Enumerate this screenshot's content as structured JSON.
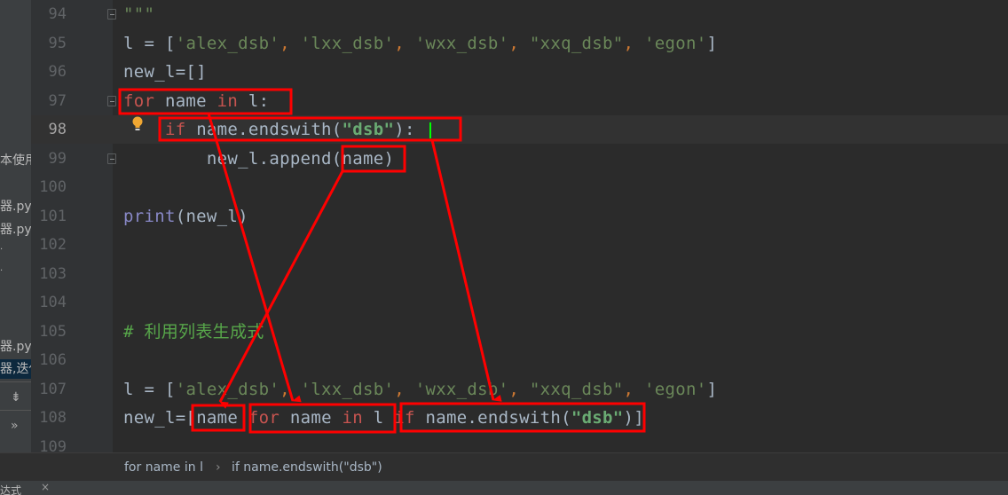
{
  "sidebar": {
    "fragments": [
      "本使用",
      "器.py",
      "器.py",
      "器.py",
      "器,迭代",
      "»"
    ]
  },
  "editor": {
    "lines": [
      {
        "num": "94",
        "tokens": [
          {
            "t": "\"\"\"",
            "c": "str"
          }
        ]
      },
      {
        "num": "95",
        "tokens": [
          {
            "t": "l = [",
            "c": ""
          },
          {
            "t": "'alex_dsb'",
            "c": "str"
          },
          {
            "t": ", ",
            "c": "kw"
          },
          {
            "t": "'lxx_dsb'",
            "c": "str"
          },
          {
            "t": ", ",
            "c": "kw"
          },
          {
            "t": "'wxx_dsb'",
            "c": "str"
          },
          {
            "t": ", ",
            "c": "kw"
          },
          {
            "t": "\"xxq_dsb\"",
            "c": "str"
          },
          {
            "t": ", ",
            "c": "kw"
          },
          {
            "t": "'egon'",
            "c": "str"
          },
          {
            "t": "]",
            "c": ""
          }
        ]
      },
      {
        "num": "96",
        "tokens": [
          {
            "t": "new_l=[]",
            "c": ""
          }
        ]
      },
      {
        "num": "97",
        "tokens": [
          {
            "t": "for",
            "c": "kwred"
          },
          {
            "t": " name ",
            "c": ""
          },
          {
            "t": "in",
            "c": "kwred"
          },
          {
            "t": " l:",
            "c": ""
          }
        ]
      },
      {
        "num": "98",
        "tokens": [
          {
            "t": "    ",
            "c": ""
          },
          {
            "t": "if",
            "c": "kwred"
          },
          {
            "t": " name.endswith(",
            "c": ""
          },
          {
            "t": "\"dsb\"",
            "c": "strg"
          },
          {
            "t": "):",
            "c": ""
          }
        ]
      },
      {
        "num": "99",
        "tokens": [
          {
            "t": "        new_l.append(name)",
            "c": ""
          }
        ]
      },
      {
        "num": "100",
        "tokens": []
      },
      {
        "num": "101",
        "tokens": [
          {
            "t": "print",
            "c": "fn"
          },
          {
            "t": "(new_l)",
            "c": ""
          }
        ]
      },
      {
        "num": "102",
        "tokens": []
      },
      {
        "num": "103",
        "tokens": []
      },
      {
        "num": "104",
        "tokens": []
      },
      {
        "num": "105",
        "tokens": [
          {
            "t": "# 利用列表生成式",
            "c": "cmt"
          }
        ]
      },
      {
        "num": "106",
        "tokens": []
      },
      {
        "num": "107",
        "tokens": [
          {
            "t": "l = [",
            "c": ""
          },
          {
            "t": "'alex_dsb'",
            "c": "str"
          },
          {
            "t": ", ",
            "c": "kw"
          },
          {
            "t": "'lxx_dsb'",
            "c": "str"
          },
          {
            "t": ", ",
            "c": "kw"
          },
          {
            "t": "'wxx_dsb'",
            "c": "str"
          },
          {
            "t": ", ",
            "c": "kw"
          },
          {
            "t": "\"xxq_dsb\"",
            "c": "str"
          },
          {
            "t": ", ",
            "c": "kw"
          },
          {
            "t": "'egon'",
            "c": "str"
          },
          {
            "t": "]",
            "c": ""
          }
        ]
      },
      {
        "num": "108",
        "tokens": [
          {
            "t": "new_l=[",
            "c": ""
          },
          {
            "t": "name ",
            "c": ""
          },
          {
            "t": "for",
            "c": "kwred"
          },
          {
            "t": " name ",
            "c": ""
          },
          {
            "t": "in",
            "c": "kwred"
          },
          {
            "t": " l ",
            "c": ""
          },
          {
            "t": "if",
            "c": "kwred"
          },
          {
            "t": " name.endswith(",
            "c": ""
          },
          {
            "t": "\"dsb\"",
            "c": "strg"
          },
          {
            "t": ")]",
            "c": ""
          }
        ]
      },
      {
        "num": "109",
        "tokens": []
      }
    ],
    "current_line": "98"
  },
  "breadcrumb": {
    "item1": "for name in l",
    "separator": "›",
    "item2": "if name.endswith(\"dsb\")"
  },
  "bottom": {
    "fragment": "达式"
  },
  "colors": {
    "background": "#2b2b2b",
    "gutter": "#313335",
    "annotation": "#ff0000",
    "caret": "#00ff00"
  }
}
